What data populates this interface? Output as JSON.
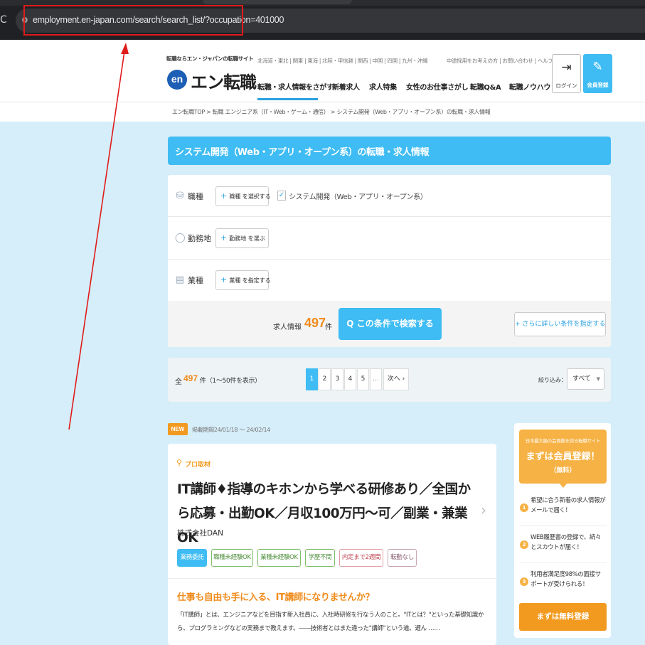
{
  "browser": {
    "url": "employment.en-japan.com/search/search_list/?occupation=401000",
    "reload_icon": "reload-icon",
    "site_info_icon": "site-info-icon"
  },
  "header": {
    "tagline": "転職ならエン・ジャパンの転職サイト",
    "logo_mark": "en",
    "logo_text": "エン転職",
    "regions": "北海道・東北 | 関東 | 東海 | 北陸・甲信越 | 関西 | 中国 | 四国 | 九州・沖縄",
    "util_links": "中途採用をお考えの方 | お問い合わせ | ヘルプ",
    "nav": [
      "転職・求人情報をさがす",
      "新着求人",
      "求人特集",
      "女性のお仕事さがし",
      "転職Q&A",
      "転職ノウハウ"
    ],
    "login_label": "ログイン",
    "register_label": "会員登録"
  },
  "breadcrumb": "エン転職TOP > 転職 エンジニア系（IT・Web・ゲーム・通信） > システム開発（Web・アプリ・オープン系）の転職・求人情報",
  "page_title": "システム開発（Web・アプリ・オープン系）の転職・求人情報",
  "search": {
    "rows": [
      {
        "label": "職種",
        "button": "職種 を選択する",
        "icon": "briefcase-icon"
      },
      {
        "label": "勤務地",
        "button": "勤務地 を選ぶ",
        "icon": "location-pin-icon"
      },
      {
        "label": "業種",
        "button": "業種 を指定する",
        "icon": "document-icon"
      }
    ],
    "selected_occupation": "システム開発（Web・アプリ・オープン系）",
    "count_label": "求人情報",
    "count_value": "497",
    "count_unit": "件",
    "search_button": "この条件で検索する",
    "detail_button": "さらに詳しい条件を指定する"
  },
  "results": {
    "total_prefix": "全",
    "total_value": "497",
    "total_suffix": "件（1～50件を表示）",
    "pages": [
      "1",
      "2",
      "3",
      "4",
      "5",
      "…"
    ],
    "next": "次へ",
    "filter_label": "絞り込み：",
    "filter_value": "すべて"
  },
  "job": {
    "badge": "NEW",
    "period": "掲載期間24/01/18 ～ 24/02/14",
    "pro_label": "プロ取材",
    "title": "IT講師♦指導のキホンから学べる研修あり／全国から応募・出勤OK／月収100万円～可／副業・兼業OK",
    "company": "株式会社DAN",
    "tags": [
      "業務委託",
      "職種未経験OK",
      "業種未経験OK",
      "学歴不問",
      "内定まで2週間",
      "転勤なし"
    ],
    "catch": "仕事も自由も手に入る、IT講師になりませんか？",
    "description": "「IT講師」とは、エンジニアなどを目指す新入社員に、入社時研修を行なう人のこと。\"ITとは？\"といった基礎知識から、プログラミングなどの実務まで教えます。――技術者とはまた違った\"講師\"という道。選ん ……"
  },
  "promo": {
    "sub": "日本最大級の会員数を誇る転職サイト",
    "main": "まずは会員登録！",
    "free": "（無料）",
    "benefits": [
      {
        "num": "1",
        "text": "希望に合う新着の求人情報がメールで届く！"
      },
      {
        "num": "2",
        "text": "WEB履歴書の登録で、続々とスカウトが届く！"
      },
      {
        "num": "3",
        "text": "利用者満足度98%の面接サポートが受けられる！"
      }
    ],
    "button": "まずは無料登録"
  },
  "colors": {
    "accent_blue": "#3ebcf3",
    "accent_orange": "#f29a1f",
    "annotation_red": "#e01b1b"
  }
}
